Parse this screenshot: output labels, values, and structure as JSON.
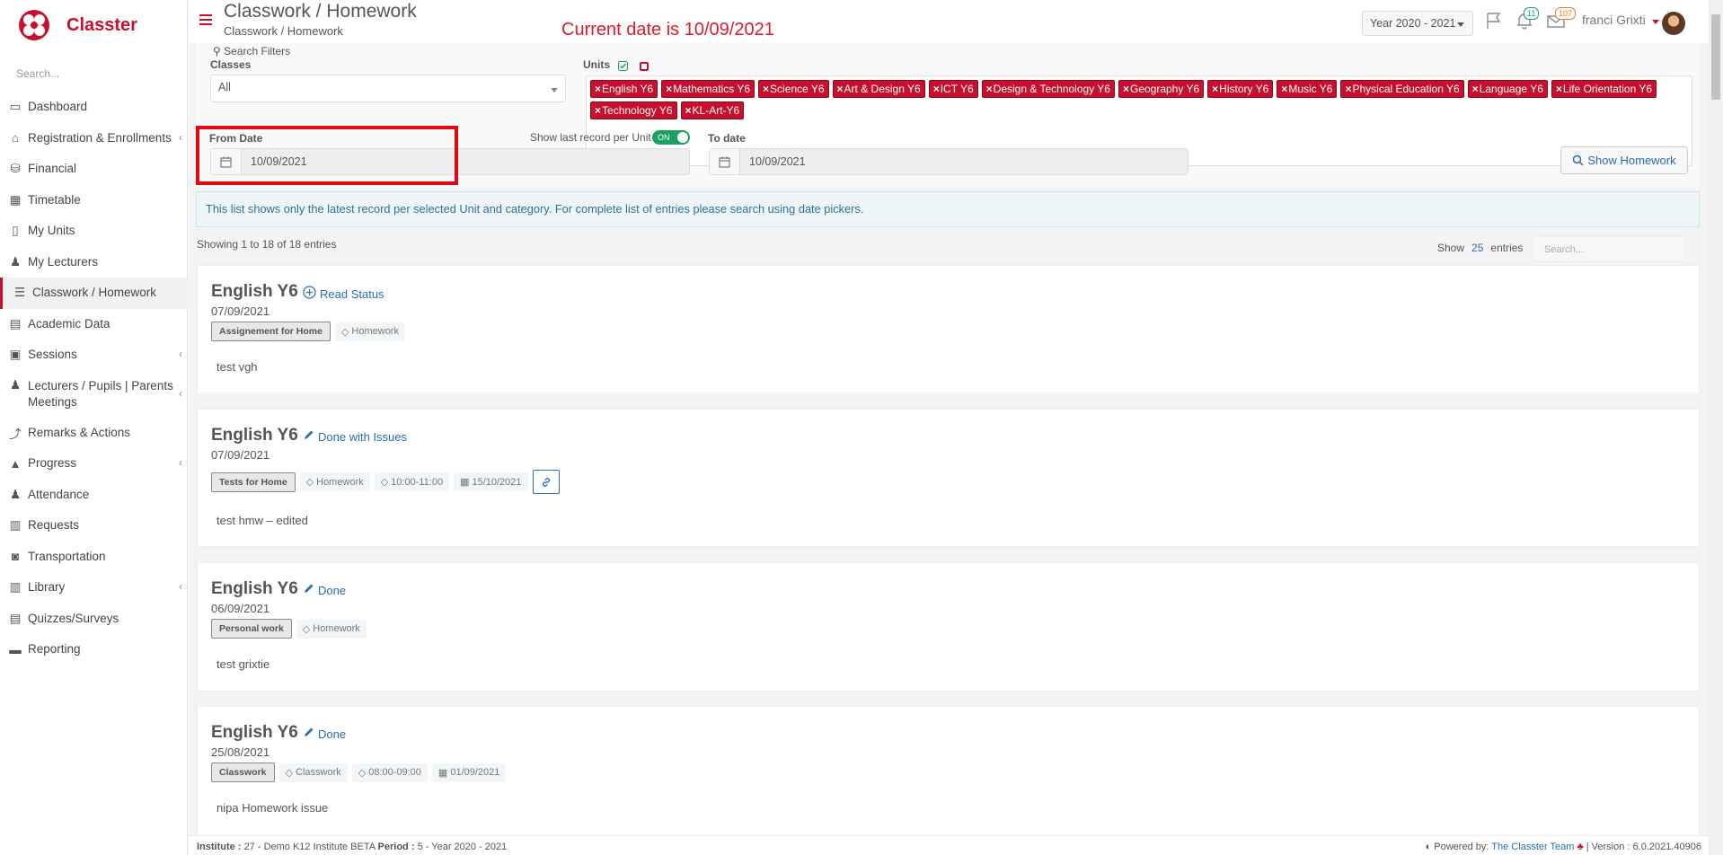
{
  "app": {
    "brand": "Classter"
  },
  "sidebar": {
    "search_placeholder": "Search...",
    "items": [
      {
        "label": "Dashboard",
        "icon": "laptop-icon"
      },
      {
        "label": "Registration & Enrollments",
        "icon": "institution-icon",
        "expandable": true
      },
      {
        "label": "Financial",
        "icon": "coins-icon"
      },
      {
        "label": "Timetable",
        "icon": "calendar-icon"
      },
      {
        "label": "My Units",
        "icon": "book-icon"
      },
      {
        "label": "My Lecturers",
        "icon": "users-icon"
      },
      {
        "label": "Classwork / Homework",
        "icon": "tasks-icon",
        "active": true
      },
      {
        "label": "Academic Data",
        "icon": "academic-data-icon"
      },
      {
        "label": "Sessions",
        "icon": "sessions-icon",
        "expandable": true
      },
      {
        "label": "Lecturers / Pupils | Parents Meetings",
        "icon": "meetings-icon",
        "expandable": true
      },
      {
        "label": "Remarks & Actions",
        "icon": "remarks-icon"
      },
      {
        "label": "Progress",
        "icon": "graduation-cap-icon",
        "expandable": true
      },
      {
        "label": "Attendance",
        "icon": "attendance-icon"
      },
      {
        "label": "Requests",
        "icon": "requests-icon"
      },
      {
        "label": "Transportation",
        "icon": "bus-icon"
      },
      {
        "label": "Library",
        "icon": "library-icon",
        "expandable": true
      },
      {
        "label": "Quizzes/Surveys",
        "icon": "quiz-icon"
      },
      {
        "label": "Reporting",
        "icon": "print-icon"
      }
    ]
  },
  "header": {
    "title": "Classwork / Homework",
    "breadcrumb": "Classwork / Homework",
    "annotation": "Current date is 10/09/2021",
    "year": "Year 2020 - 2021",
    "notifications_count": "11",
    "messages_count": "107",
    "user_name": "franci Grixti"
  },
  "filters": {
    "search_filters_label": "Search Filters",
    "classes_label": "Classes",
    "classes_value": "All",
    "units_label": "Units",
    "units": [
      "English Y6",
      "Mathematics Y6",
      "Science Y6",
      "Art & Design Y6",
      "ICT Y6",
      "Design & Technology Y6",
      "Geography Y6",
      "History Y6",
      "Music Y6",
      "Physical Education Y6",
      "Language Y6",
      "Life Orientation Y6",
      "Technology Y6",
      "KL-Art-Y6"
    ],
    "from_date_label": "From Date",
    "from_date_value": "10/09/2021",
    "toggle_label": "Show last record per Unit",
    "toggle_value": "ON",
    "to_date_label": "To date",
    "to_date_value": "10/09/2021",
    "show_button": "Show Homework"
  },
  "info_text": "This list shows only the latest record per selected Unit and category. For complete list of entries please search using date pickers.",
  "table": {
    "showing": "Showing 1 to 18 of 18 entries",
    "show_label": "Show",
    "page_size": "25",
    "entries_label": "entries",
    "search_placeholder": "Search..."
  },
  "cards": [
    {
      "title": "English Y6",
      "status": "Read Status",
      "status_icon": "plus-circle-icon",
      "date": "07/09/2021",
      "category": "Assignement for Home",
      "type": "Homework",
      "time": "",
      "due": "",
      "link": false,
      "description": "test vgh"
    },
    {
      "title": "English Y6",
      "status": "Done with Issues",
      "status_icon": "pencil-icon",
      "date": "07/09/2021",
      "category": "Tests for Home",
      "type": "Homework",
      "time": "10:00-11:00",
      "due": "15/10/2021",
      "link": true,
      "description": "test hmw – edited"
    },
    {
      "title": "English Y6",
      "status": "Done",
      "status_icon": "pencil-icon",
      "date": "06/09/2021",
      "category": "Personal work",
      "type": "Homework",
      "time": "",
      "due": "",
      "link": false,
      "description": "test grixtie"
    },
    {
      "title": "English Y6",
      "status": "Done",
      "status_icon": "pencil-icon",
      "date": "25/08/2021",
      "category": "Classwork",
      "type": "Classwork",
      "time": "08:00-09:00",
      "due": "01/09/2021",
      "link": false,
      "description": "nipa Homework issue"
    }
  ],
  "footer": {
    "institute_label": "Institute :",
    "institute_value": "27 - Demo K12 Institute BETA",
    "period_label": "Period :",
    "period_value": "5 - Year 2020 - 2021",
    "powered_by": "Powered by:",
    "team": "The Classter Team",
    "version": "| Version : 6.0.2021.40906"
  },
  "colors": {
    "brand": "#c8102e",
    "link": "#2a6ead",
    "toggle_on": "#1aa160",
    "annotation": "#e3192b"
  }
}
